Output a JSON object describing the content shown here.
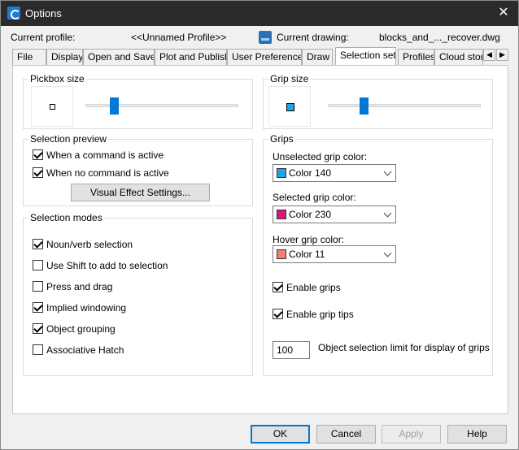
{
  "window": {
    "title": "Options"
  },
  "header": {
    "current_profile_label": "Current profile:",
    "current_profile_value": "<<Unnamed Profile>>",
    "current_drawing_label": "Current drawing:",
    "current_drawing_value": "blocks_and_..._recover.dwg"
  },
  "tabs": [
    "File",
    "Display",
    "Open and Save",
    "Plot and Publish",
    "User Preferences",
    "Draw",
    "Selection set",
    "Profiles",
    "Cloud stora"
  ],
  "active_tab": "Selection set",
  "tab_scroll": {
    "left": "◀",
    "right": "▶"
  },
  "pickbox": {
    "title": "Pickbox size",
    "slider_fraction": 0.17
  },
  "grip_size": {
    "title": "Grip size",
    "slider_fraction": 0.22
  },
  "selection_preview": {
    "title": "Selection preview",
    "items": [
      {
        "label": "When a command is active",
        "checked": true
      },
      {
        "label": "When no command is active",
        "checked": true
      }
    ],
    "button_label": "Visual Effect Settings..."
  },
  "selection_modes": {
    "title": "Selection modes",
    "items": [
      {
        "label": "Noun/verb selection",
        "checked": true
      },
      {
        "label": "Use Shift to add to selection",
        "checked": false
      },
      {
        "label": "Press and drag",
        "checked": false
      },
      {
        "label": "Implied windowing",
        "checked": true
      },
      {
        "label": "Object grouping",
        "checked": true
      },
      {
        "label": "Associative Hatch",
        "checked": false
      }
    ]
  },
  "grips": {
    "title": "Grips",
    "unselected_label": "Unselected grip color:",
    "unselected_value": "Color 140",
    "unselected_color": "#1ea5e8",
    "selected_label": "Selected grip color:",
    "selected_value": "Color 230",
    "selected_color": "#d9167a",
    "hover_label": "Hover grip color:",
    "hover_value": "Color 11",
    "hover_color": "#f07f6f",
    "enable_grips_label": "Enable grips",
    "enable_grips_checked": true,
    "enable_grip_tips_label": "Enable grip tips",
    "enable_grip_tips_checked": true,
    "limit_value": "100",
    "limit_label": "Object selection limit for display of grips"
  },
  "buttons": {
    "ok": "OK",
    "cancel": "Cancel",
    "apply": "Apply",
    "help": "Help"
  },
  "colors": {
    "accent": "#0078d7",
    "titlebar": "#2b2b2b",
    "grip_preview": "#1ea5e8"
  }
}
